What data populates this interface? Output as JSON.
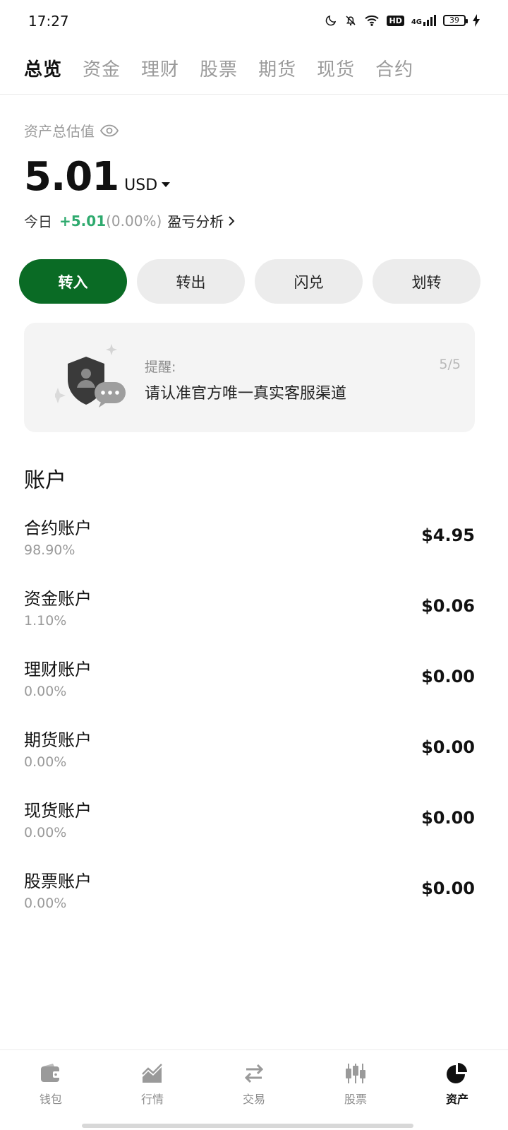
{
  "status_bar": {
    "time": "17:27",
    "hd_badge": "HD",
    "network": "4G",
    "battery": "39"
  },
  "top_tabs": [
    "总览",
    "资金",
    "理财",
    "股票",
    "期货",
    "现货",
    "合约"
  ],
  "overview": {
    "total_label": "资产总估值",
    "total_value": "5.01",
    "unit": "USD",
    "today_label": "今日",
    "today_change": "+5.01",
    "today_pct": "(0.00%)",
    "analysis_link": "盈亏分析"
  },
  "actions": {
    "deposit": "转入",
    "withdraw": "转出",
    "convert": "闪兑",
    "transfer": "划转"
  },
  "reminder": {
    "label": "提醒:",
    "text": "请认准官方唯一真实客服渠道",
    "page": "5/5"
  },
  "accounts": {
    "title": "账户",
    "items": [
      {
        "name": "合约账户",
        "pct": "98.90%",
        "balance": "$4.95"
      },
      {
        "name": "资金账户",
        "pct": "1.10%",
        "balance": "$0.06"
      },
      {
        "name": "理财账户",
        "pct": "0.00%",
        "balance": "$0.00"
      },
      {
        "name": "期货账户",
        "pct": "0.00%",
        "balance": "$0.00"
      },
      {
        "name": "现货账户",
        "pct": "0.00%",
        "balance": "$0.00"
      },
      {
        "name": "股票账户",
        "pct": "0.00%",
        "balance": "$0.00"
      }
    ]
  },
  "bottom_nav": {
    "items": [
      {
        "label": "钱包",
        "icon": "wallet-icon"
      },
      {
        "label": "行情",
        "icon": "market-chart-icon"
      },
      {
        "label": "交易",
        "icon": "swap-arrows-icon"
      },
      {
        "label": "股票",
        "icon": "candlestick-icon"
      },
      {
        "label": "资产",
        "icon": "pie-chart-icon"
      }
    ],
    "active_index": 4
  },
  "colors": {
    "primary_green": "#0a6b25",
    "profit_green": "#2eaa6e"
  }
}
